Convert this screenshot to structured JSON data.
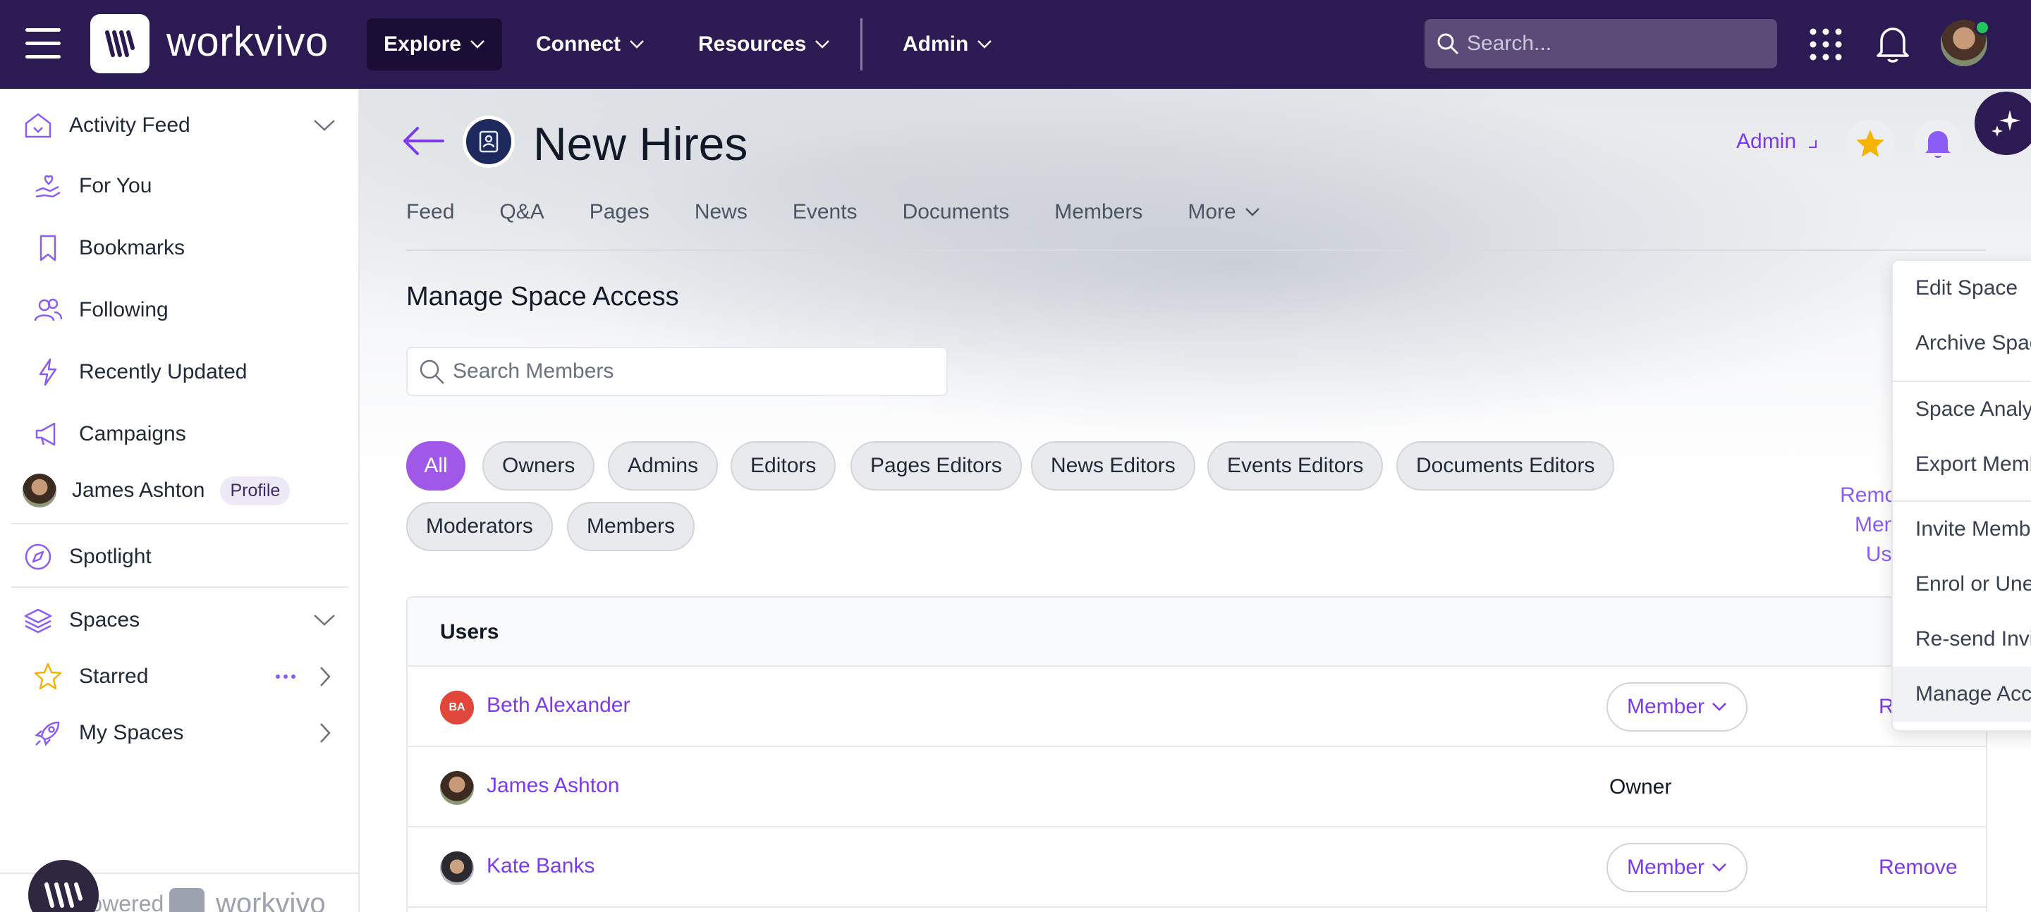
{
  "brand": {
    "name": "workvivo"
  },
  "topnav": {
    "items": [
      "Explore",
      "Connect",
      "Resources",
      "Admin"
    ],
    "search_placeholder": "Search..."
  },
  "sidebar": {
    "activity_feed": "Activity Feed",
    "items": [
      "For You",
      "Bookmarks",
      "Following",
      "Recently Updated",
      "Campaigns"
    ],
    "profile_name": "James Ashton",
    "profile_badge": "Profile",
    "spotlight": "Spotlight",
    "spaces": "Spaces",
    "starred": "Starred",
    "my_spaces": "My Spaces",
    "powered_by": "Powered by",
    "powered_brand": "workvivo"
  },
  "space": {
    "title": "New Hires",
    "admin_label": "Admin",
    "tabs": [
      "Feed",
      "Q&A",
      "Pages",
      "News",
      "Events",
      "Documents",
      "Members",
      "More"
    ]
  },
  "access": {
    "title": "Manage Space Access",
    "search_placeholder": "Search Members",
    "filters": [
      "All",
      "Owners",
      "Admins",
      "Editors",
      "Pages Editors",
      "News Editors",
      "Events Editors",
      "Documents Editors",
      "Moderators",
      "Members"
    ],
    "remove_all_line1": "Remove All Member",
    "remove_all_line2": "Users",
    "table_header": "Users",
    "rows": [
      {
        "initials": "BA",
        "name": "Beth Alexander",
        "role": "Member",
        "action": "Remove"
      },
      {
        "initials": "",
        "name": "James Ashton",
        "role": "Owner",
        "action": ""
      },
      {
        "initials": "",
        "name": "Kate Banks",
        "role": "Member",
        "action": "Remove"
      }
    ]
  },
  "admin_menu": {
    "items": [
      "Edit Space",
      "Archive Space",
      "Space Analytics",
      "Export Members",
      "Invite Members",
      "Enrol or Unenrol Members",
      "Re-send Invites",
      "Manage Access"
    ],
    "highlighted": "Manage Access"
  },
  "colors": {
    "topnav_bg": "#2c1a52",
    "accent": "#7c3aed",
    "chip_active": "#9f58e8",
    "star": "#f5b400"
  }
}
